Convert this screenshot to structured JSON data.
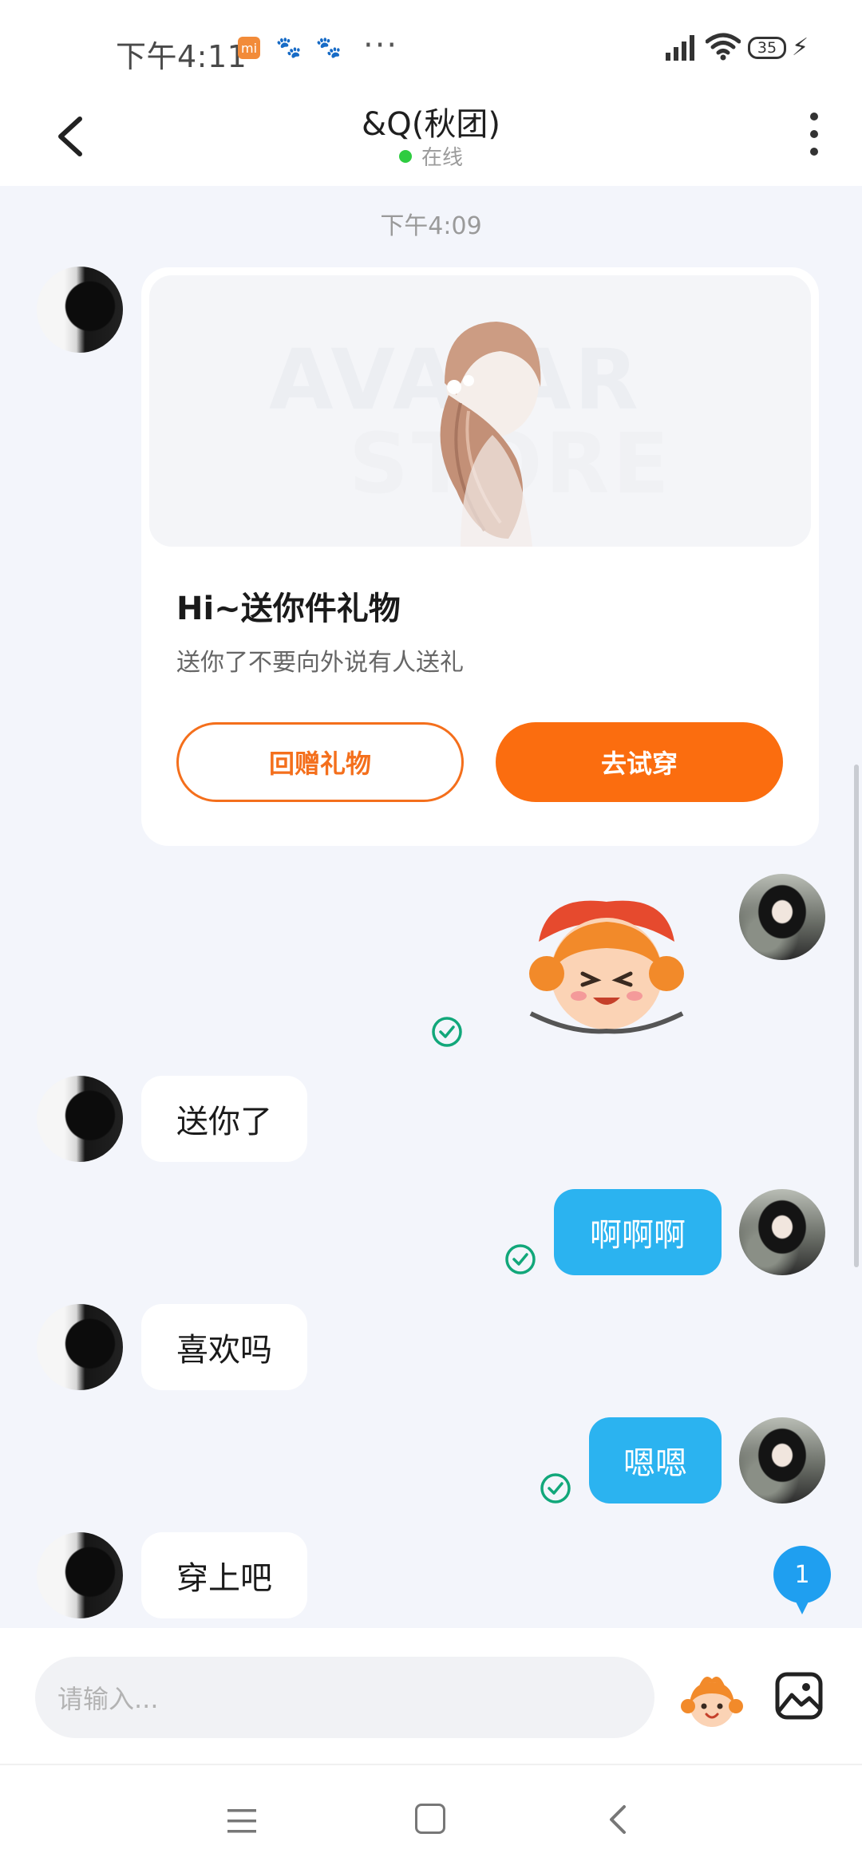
{
  "status_bar": {
    "time": "下午4:11",
    "mi_label": "mi",
    "battery": "35"
  },
  "header": {
    "title": "&Q(秋团)",
    "status": "在线"
  },
  "chat": {
    "timestamp": "下午4:09",
    "gift_card": {
      "title": "Hi~送你件礼物",
      "description": "送你了不要向外说有人送礼",
      "return_gift_label": "回赠礼物",
      "try_on_label": "去试穿",
      "watermark_line1": "AVATAR",
      "watermark_line2": "STORE"
    },
    "messages": [
      {
        "from": "them",
        "text": "送你了"
      },
      {
        "from": "me",
        "text": "啊啊啊"
      },
      {
        "from": "them",
        "text": "喜欢吗"
      },
      {
        "from": "me",
        "text": "嗯嗯"
      },
      {
        "from": "them",
        "text": "穿上吧"
      }
    ],
    "unread_count": "1"
  },
  "input": {
    "placeholder": "请输入..."
  },
  "colors": {
    "accent_orange": "#fb6d0f",
    "my_bubble_blue": "#2bb3f0",
    "online_green": "#2ecc40",
    "read_check_green": "#11a77a"
  }
}
